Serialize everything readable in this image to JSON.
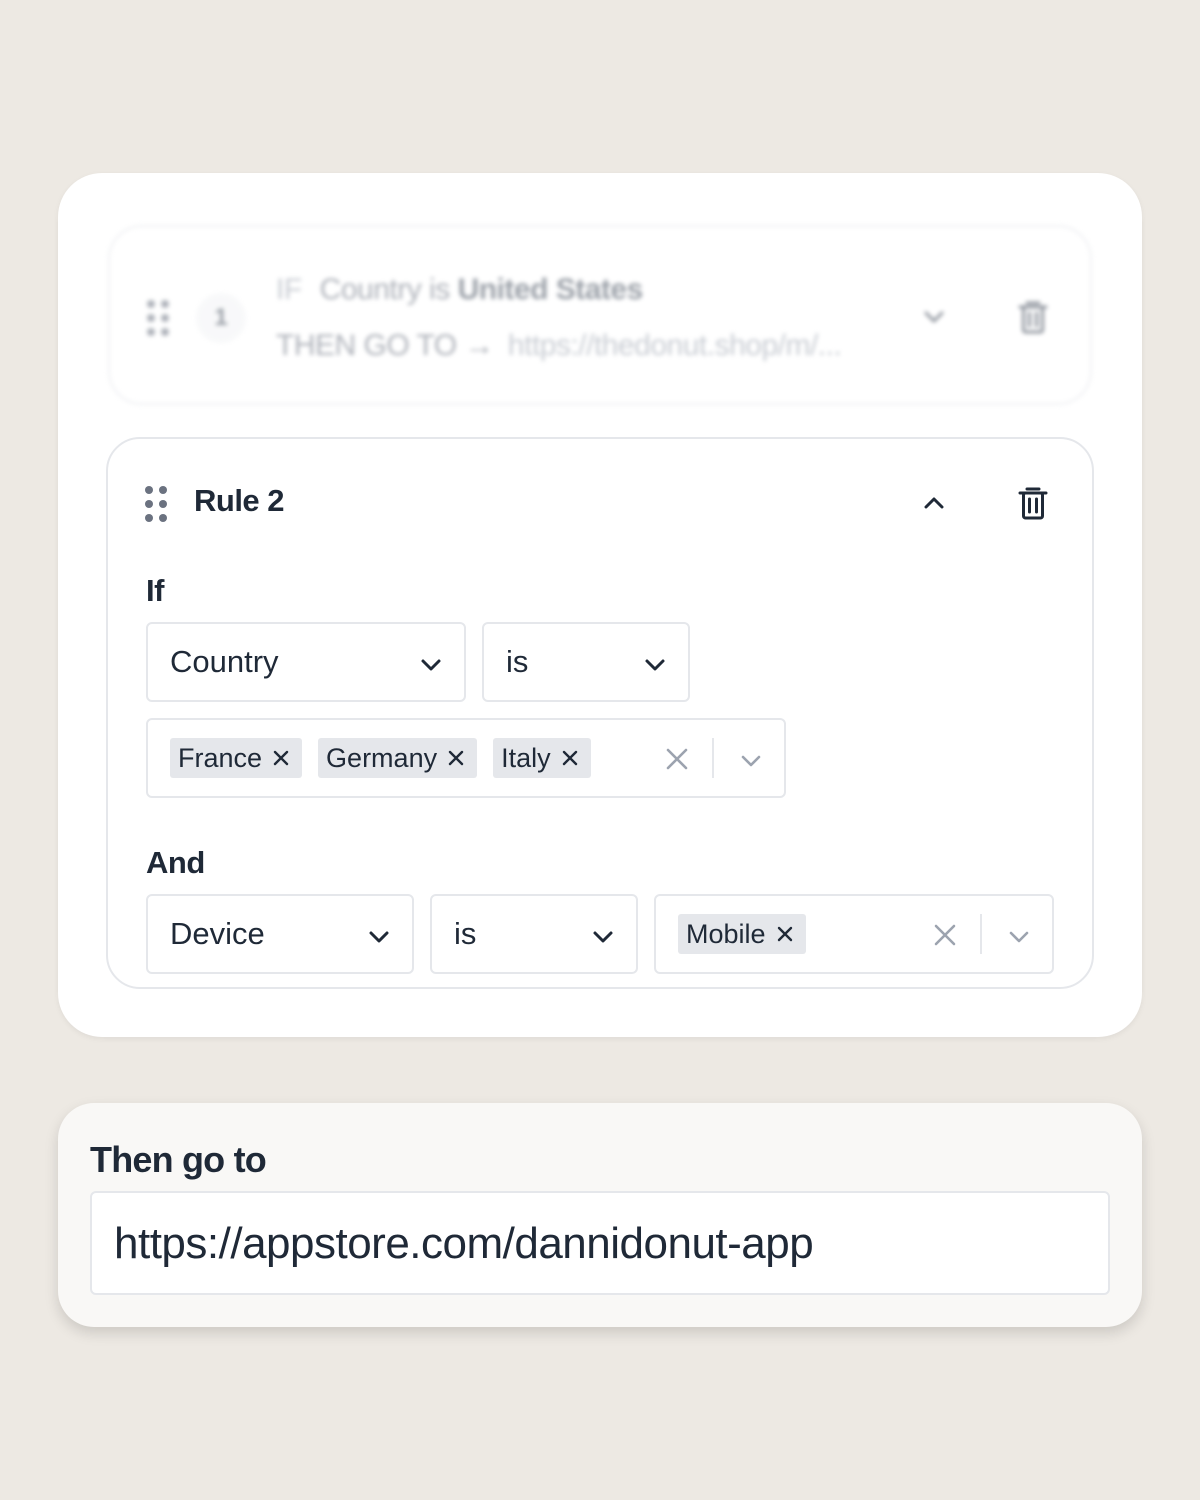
{
  "rule1": {
    "number": "1",
    "if_keyword": "IF",
    "condition_text": "Country is",
    "condition_value": "United States",
    "then_text": "THEN GO TO →",
    "then_url": "https://thedonut.shop/m/..."
  },
  "rule2": {
    "title": "Rule 2",
    "if_label": "If",
    "and_label": "And",
    "condition1": {
      "field": "Country",
      "operator": "is",
      "values": [
        "France",
        "Germany",
        "Italy"
      ]
    },
    "condition2": {
      "field": "Device",
      "operator": "is",
      "values": [
        "Mobile"
      ]
    }
  },
  "then": {
    "label": "Then go to",
    "url": "https://appstore.com/dannidonut-app"
  },
  "icons": {
    "drag": "drag-handle-icon",
    "collapse": "chevron-up-icon",
    "expand": "chevron-down-icon",
    "delete": "trash-icon",
    "remove": "close-icon"
  },
  "colors": {
    "background": "#ede9e3",
    "card": "#ffffff",
    "text": "#1f2937",
    "muted": "#9ca3af",
    "tag": "#e5e7eb"
  }
}
